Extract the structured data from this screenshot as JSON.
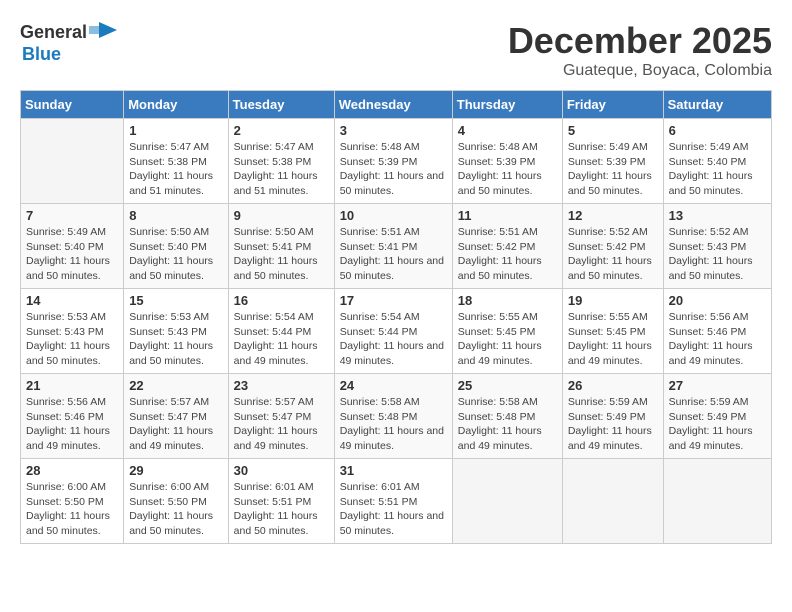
{
  "header": {
    "logo_general": "General",
    "logo_blue": "Blue",
    "month": "December 2025",
    "location": "Guateque, Boyaca, Colombia"
  },
  "days_of_week": [
    "Sunday",
    "Monday",
    "Tuesday",
    "Wednesday",
    "Thursday",
    "Friday",
    "Saturday"
  ],
  "weeks": [
    [
      {
        "day": "",
        "sunrise": "",
        "sunset": "",
        "daylight": ""
      },
      {
        "day": "1",
        "sunrise": "Sunrise: 5:47 AM",
        "sunset": "Sunset: 5:38 PM",
        "daylight": "Daylight: 11 hours and 51 minutes."
      },
      {
        "day": "2",
        "sunrise": "Sunrise: 5:47 AM",
        "sunset": "Sunset: 5:38 PM",
        "daylight": "Daylight: 11 hours and 51 minutes."
      },
      {
        "day": "3",
        "sunrise": "Sunrise: 5:48 AM",
        "sunset": "Sunset: 5:39 PM",
        "daylight": "Daylight: 11 hours and 50 minutes."
      },
      {
        "day": "4",
        "sunrise": "Sunrise: 5:48 AM",
        "sunset": "Sunset: 5:39 PM",
        "daylight": "Daylight: 11 hours and 50 minutes."
      },
      {
        "day": "5",
        "sunrise": "Sunrise: 5:49 AM",
        "sunset": "Sunset: 5:39 PM",
        "daylight": "Daylight: 11 hours and 50 minutes."
      },
      {
        "day": "6",
        "sunrise": "Sunrise: 5:49 AM",
        "sunset": "Sunset: 5:40 PM",
        "daylight": "Daylight: 11 hours and 50 minutes."
      }
    ],
    [
      {
        "day": "7",
        "sunrise": "Sunrise: 5:49 AM",
        "sunset": "Sunset: 5:40 PM",
        "daylight": "Daylight: 11 hours and 50 minutes."
      },
      {
        "day": "8",
        "sunrise": "Sunrise: 5:50 AM",
        "sunset": "Sunset: 5:40 PM",
        "daylight": "Daylight: 11 hours and 50 minutes."
      },
      {
        "day": "9",
        "sunrise": "Sunrise: 5:50 AM",
        "sunset": "Sunset: 5:41 PM",
        "daylight": "Daylight: 11 hours and 50 minutes."
      },
      {
        "day": "10",
        "sunrise": "Sunrise: 5:51 AM",
        "sunset": "Sunset: 5:41 PM",
        "daylight": "Daylight: 11 hours and 50 minutes."
      },
      {
        "day": "11",
        "sunrise": "Sunrise: 5:51 AM",
        "sunset": "Sunset: 5:42 PM",
        "daylight": "Daylight: 11 hours and 50 minutes."
      },
      {
        "day": "12",
        "sunrise": "Sunrise: 5:52 AM",
        "sunset": "Sunset: 5:42 PM",
        "daylight": "Daylight: 11 hours and 50 minutes."
      },
      {
        "day": "13",
        "sunrise": "Sunrise: 5:52 AM",
        "sunset": "Sunset: 5:43 PM",
        "daylight": "Daylight: 11 hours and 50 minutes."
      }
    ],
    [
      {
        "day": "14",
        "sunrise": "Sunrise: 5:53 AM",
        "sunset": "Sunset: 5:43 PM",
        "daylight": "Daylight: 11 hours and 50 minutes."
      },
      {
        "day": "15",
        "sunrise": "Sunrise: 5:53 AM",
        "sunset": "Sunset: 5:43 PM",
        "daylight": "Daylight: 11 hours and 50 minutes."
      },
      {
        "day": "16",
        "sunrise": "Sunrise: 5:54 AM",
        "sunset": "Sunset: 5:44 PM",
        "daylight": "Daylight: 11 hours and 49 minutes."
      },
      {
        "day": "17",
        "sunrise": "Sunrise: 5:54 AM",
        "sunset": "Sunset: 5:44 PM",
        "daylight": "Daylight: 11 hours and 49 minutes."
      },
      {
        "day": "18",
        "sunrise": "Sunrise: 5:55 AM",
        "sunset": "Sunset: 5:45 PM",
        "daylight": "Daylight: 11 hours and 49 minutes."
      },
      {
        "day": "19",
        "sunrise": "Sunrise: 5:55 AM",
        "sunset": "Sunset: 5:45 PM",
        "daylight": "Daylight: 11 hours and 49 minutes."
      },
      {
        "day": "20",
        "sunrise": "Sunrise: 5:56 AM",
        "sunset": "Sunset: 5:46 PM",
        "daylight": "Daylight: 11 hours and 49 minutes."
      }
    ],
    [
      {
        "day": "21",
        "sunrise": "Sunrise: 5:56 AM",
        "sunset": "Sunset: 5:46 PM",
        "daylight": "Daylight: 11 hours and 49 minutes."
      },
      {
        "day": "22",
        "sunrise": "Sunrise: 5:57 AM",
        "sunset": "Sunset: 5:47 PM",
        "daylight": "Daylight: 11 hours and 49 minutes."
      },
      {
        "day": "23",
        "sunrise": "Sunrise: 5:57 AM",
        "sunset": "Sunset: 5:47 PM",
        "daylight": "Daylight: 11 hours and 49 minutes."
      },
      {
        "day": "24",
        "sunrise": "Sunrise: 5:58 AM",
        "sunset": "Sunset: 5:48 PM",
        "daylight": "Daylight: 11 hours and 49 minutes."
      },
      {
        "day": "25",
        "sunrise": "Sunrise: 5:58 AM",
        "sunset": "Sunset: 5:48 PM",
        "daylight": "Daylight: 11 hours and 49 minutes."
      },
      {
        "day": "26",
        "sunrise": "Sunrise: 5:59 AM",
        "sunset": "Sunset: 5:49 PM",
        "daylight": "Daylight: 11 hours and 49 minutes."
      },
      {
        "day": "27",
        "sunrise": "Sunrise: 5:59 AM",
        "sunset": "Sunset: 5:49 PM",
        "daylight": "Daylight: 11 hours and 49 minutes."
      }
    ],
    [
      {
        "day": "28",
        "sunrise": "Sunrise: 6:00 AM",
        "sunset": "Sunset: 5:50 PM",
        "daylight": "Daylight: 11 hours and 50 minutes."
      },
      {
        "day": "29",
        "sunrise": "Sunrise: 6:00 AM",
        "sunset": "Sunset: 5:50 PM",
        "daylight": "Daylight: 11 hours and 50 minutes."
      },
      {
        "day": "30",
        "sunrise": "Sunrise: 6:01 AM",
        "sunset": "Sunset: 5:51 PM",
        "daylight": "Daylight: 11 hours and 50 minutes."
      },
      {
        "day": "31",
        "sunrise": "Sunrise: 6:01 AM",
        "sunset": "Sunset: 5:51 PM",
        "daylight": "Daylight: 11 hours and 50 minutes."
      },
      {
        "day": "",
        "sunrise": "",
        "sunset": "",
        "daylight": ""
      },
      {
        "day": "",
        "sunrise": "",
        "sunset": "",
        "daylight": ""
      },
      {
        "day": "",
        "sunrise": "",
        "sunset": "",
        "daylight": ""
      }
    ]
  ]
}
